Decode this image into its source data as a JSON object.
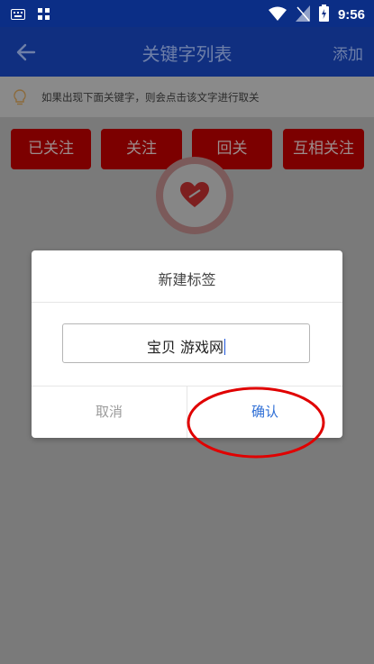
{
  "status_bar": {
    "time": "9:56"
  },
  "app_bar": {
    "title": "关键字列表",
    "add_label": "添加"
  },
  "hint": {
    "text": "如果出现下面关键字，则会点击该文字进行取关"
  },
  "filters": [
    {
      "label": "已关注"
    },
    {
      "label": "关注"
    },
    {
      "label": "回关"
    },
    {
      "label": "互相关注"
    }
  ],
  "dialog": {
    "title": "新建标签",
    "input_value": "宝贝 游戏网",
    "cancel_label": "取消",
    "confirm_label": "确认"
  },
  "colors": {
    "primary": "#102f80",
    "filter_button": "#7c0000",
    "confirm_text": "#2f6fd6",
    "annotation": "#e00000"
  }
}
